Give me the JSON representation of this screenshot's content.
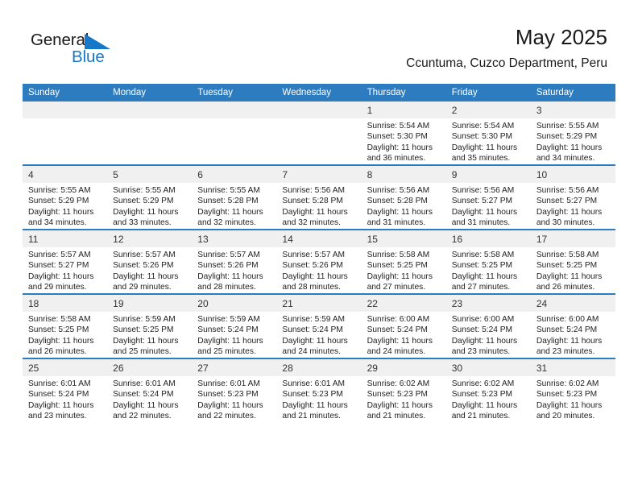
{
  "logo": {
    "primary_text": "General",
    "secondary_text": "Blue",
    "accent_color": "#1878c8",
    "triangle_icon": "triangle-icon"
  },
  "header": {
    "title": "May 2025",
    "subtitle": "Ccuntuma, Cuzco Department, Peru"
  },
  "colors": {
    "header_blue": "#2e7cc0",
    "daynum_band": "#f0f0f0",
    "text": "#222222"
  },
  "weekday_headers": [
    "Sunday",
    "Monday",
    "Tuesday",
    "Wednesday",
    "Thursday",
    "Friday",
    "Saturday"
  ],
  "weeks": [
    [
      {
        "day": "",
        "empty": true
      },
      {
        "day": "",
        "empty": true
      },
      {
        "day": "",
        "empty": true
      },
      {
        "day": "",
        "empty": true
      },
      {
        "day": "1",
        "sunrise": "Sunrise: 5:54 AM",
        "sunset": "Sunset: 5:30 PM",
        "daylight_1": "Daylight: 11 hours",
        "daylight_2": "and 36 minutes."
      },
      {
        "day": "2",
        "sunrise": "Sunrise: 5:54 AM",
        "sunset": "Sunset: 5:30 PM",
        "daylight_1": "Daylight: 11 hours",
        "daylight_2": "and 35 minutes."
      },
      {
        "day": "3",
        "sunrise": "Sunrise: 5:55 AM",
        "sunset": "Sunset: 5:29 PM",
        "daylight_1": "Daylight: 11 hours",
        "daylight_2": "and 34 minutes."
      }
    ],
    [
      {
        "day": "4",
        "sunrise": "Sunrise: 5:55 AM",
        "sunset": "Sunset: 5:29 PM",
        "daylight_1": "Daylight: 11 hours",
        "daylight_2": "and 34 minutes."
      },
      {
        "day": "5",
        "sunrise": "Sunrise: 5:55 AM",
        "sunset": "Sunset: 5:29 PM",
        "daylight_1": "Daylight: 11 hours",
        "daylight_2": "and 33 minutes."
      },
      {
        "day": "6",
        "sunrise": "Sunrise: 5:55 AM",
        "sunset": "Sunset: 5:28 PM",
        "daylight_1": "Daylight: 11 hours",
        "daylight_2": "and 32 minutes."
      },
      {
        "day": "7",
        "sunrise": "Sunrise: 5:56 AM",
        "sunset": "Sunset: 5:28 PM",
        "daylight_1": "Daylight: 11 hours",
        "daylight_2": "and 32 minutes."
      },
      {
        "day": "8",
        "sunrise": "Sunrise: 5:56 AM",
        "sunset": "Sunset: 5:28 PM",
        "daylight_1": "Daylight: 11 hours",
        "daylight_2": "and 31 minutes."
      },
      {
        "day": "9",
        "sunrise": "Sunrise: 5:56 AM",
        "sunset": "Sunset: 5:27 PM",
        "daylight_1": "Daylight: 11 hours",
        "daylight_2": "and 31 minutes."
      },
      {
        "day": "10",
        "sunrise": "Sunrise: 5:56 AM",
        "sunset": "Sunset: 5:27 PM",
        "daylight_1": "Daylight: 11 hours",
        "daylight_2": "and 30 minutes."
      }
    ],
    [
      {
        "day": "11",
        "sunrise": "Sunrise: 5:57 AM",
        "sunset": "Sunset: 5:27 PM",
        "daylight_1": "Daylight: 11 hours",
        "daylight_2": "and 29 minutes."
      },
      {
        "day": "12",
        "sunrise": "Sunrise: 5:57 AM",
        "sunset": "Sunset: 5:26 PM",
        "daylight_1": "Daylight: 11 hours",
        "daylight_2": "and 29 minutes."
      },
      {
        "day": "13",
        "sunrise": "Sunrise: 5:57 AM",
        "sunset": "Sunset: 5:26 PM",
        "daylight_1": "Daylight: 11 hours",
        "daylight_2": "and 28 minutes."
      },
      {
        "day": "14",
        "sunrise": "Sunrise: 5:57 AM",
        "sunset": "Sunset: 5:26 PM",
        "daylight_1": "Daylight: 11 hours",
        "daylight_2": "and 28 minutes."
      },
      {
        "day": "15",
        "sunrise": "Sunrise: 5:58 AM",
        "sunset": "Sunset: 5:25 PM",
        "daylight_1": "Daylight: 11 hours",
        "daylight_2": "and 27 minutes."
      },
      {
        "day": "16",
        "sunrise": "Sunrise: 5:58 AM",
        "sunset": "Sunset: 5:25 PM",
        "daylight_1": "Daylight: 11 hours",
        "daylight_2": "and 27 minutes."
      },
      {
        "day": "17",
        "sunrise": "Sunrise: 5:58 AM",
        "sunset": "Sunset: 5:25 PM",
        "daylight_1": "Daylight: 11 hours",
        "daylight_2": "and 26 minutes."
      }
    ],
    [
      {
        "day": "18",
        "sunrise": "Sunrise: 5:58 AM",
        "sunset": "Sunset: 5:25 PM",
        "daylight_1": "Daylight: 11 hours",
        "daylight_2": "and 26 minutes."
      },
      {
        "day": "19",
        "sunrise": "Sunrise: 5:59 AM",
        "sunset": "Sunset: 5:25 PM",
        "daylight_1": "Daylight: 11 hours",
        "daylight_2": "and 25 minutes."
      },
      {
        "day": "20",
        "sunrise": "Sunrise: 5:59 AM",
        "sunset": "Sunset: 5:24 PM",
        "daylight_1": "Daylight: 11 hours",
        "daylight_2": "and 25 minutes."
      },
      {
        "day": "21",
        "sunrise": "Sunrise: 5:59 AM",
        "sunset": "Sunset: 5:24 PM",
        "daylight_1": "Daylight: 11 hours",
        "daylight_2": "and 24 minutes."
      },
      {
        "day": "22",
        "sunrise": "Sunrise: 6:00 AM",
        "sunset": "Sunset: 5:24 PM",
        "daylight_1": "Daylight: 11 hours",
        "daylight_2": "and 24 minutes."
      },
      {
        "day": "23",
        "sunrise": "Sunrise: 6:00 AM",
        "sunset": "Sunset: 5:24 PM",
        "daylight_1": "Daylight: 11 hours",
        "daylight_2": "and 23 minutes."
      },
      {
        "day": "24",
        "sunrise": "Sunrise: 6:00 AM",
        "sunset": "Sunset: 5:24 PM",
        "daylight_1": "Daylight: 11 hours",
        "daylight_2": "and 23 minutes."
      }
    ],
    [
      {
        "day": "25",
        "sunrise": "Sunrise: 6:01 AM",
        "sunset": "Sunset: 5:24 PM",
        "daylight_1": "Daylight: 11 hours",
        "daylight_2": "and 23 minutes."
      },
      {
        "day": "26",
        "sunrise": "Sunrise: 6:01 AM",
        "sunset": "Sunset: 5:24 PM",
        "daylight_1": "Daylight: 11 hours",
        "daylight_2": "and 22 minutes."
      },
      {
        "day": "27",
        "sunrise": "Sunrise: 6:01 AM",
        "sunset": "Sunset: 5:23 PM",
        "daylight_1": "Daylight: 11 hours",
        "daylight_2": "and 22 minutes."
      },
      {
        "day": "28",
        "sunrise": "Sunrise: 6:01 AM",
        "sunset": "Sunset: 5:23 PM",
        "daylight_1": "Daylight: 11 hours",
        "daylight_2": "and 21 minutes."
      },
      {
        "day": "29",
        "sunrise": "Sunrise: 6:02 AM",
        "sunset": "Sunset: 5:23 PM",
        "daylight_1": "Daylight: 11 hours",
        "daylight_2": "and 21 minutes."
      },
      {
        "day": "30",
        "sunrise": "Sunrise: 6:02 AM",
        "sunset": "Sunset: 5:23 PM",
        "daylight_1": "Daylight: 11 hours",
        "daylight_2": "and 21 minutes."
      },
      {
        "day": "31",
        "sunrise": "Sunrise: 6:02 AM",
        "sunset": "Sunset: 5:23 PM",
        "daylight_1": "Daylight: 11 hours",
        "daylight_2": "and 20 minutes."
      }
    ]
  ]
}
